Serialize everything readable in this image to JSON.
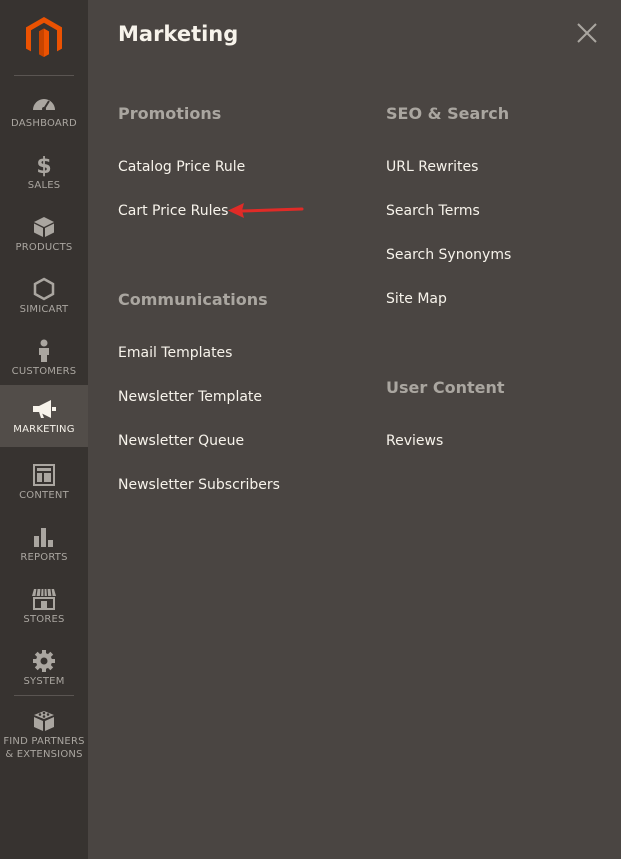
{
  "sidebar": {
    "items": [
      {
        "id": "dashboard",
        "label": "DASHBOARD",
        "icon": "dashboard-gauge-icon"
      },
      {
        "id": "sales",
        "label": "SALES",
        "icon": "dollar-icon"
      },
      {
        "id": "products",
        "label": "PRODUCTS",
        "icon": "box-icon"
      },
      {
        "id": "simicart",
        "label": "SIMICART",
        "icon": "hexagon-icon"
      },
      {
        "id": "customers",
        "label": "CUSTOMERS",
        "icon": "person-icon"
      },
      {
        "id": "marketing",
        "label": "MARKETING",
        "icon": "megaphone-icon",
        "active": true
      },
      {
        "id": "content",
        "label": "CONTENT",
        "icon": "layout-icon"
      },
      {
        "id": "reports",
        "label": "REPORTS",
        "icon": "bar-chart-icon"
      },
      {
        "id": "stores",
        "label": "STORES",
        "icon": "storefront-icon"
      },
      {
        "id": "system",
        "label": "SYSTEM",
        "icon": "gear-icon"
      }
    ],
    "partners": {
      "line1": "FIND PARTNERS",
      "line2": "& EXTENSIONS",
      "icon": "blocks-icon"
    }
  },
  "panel": {
    "title": "Marketing",
    "promotions": {
      "heading": "Promotions",
      "links": [
        "Catalog Price Rule",
        "Cart Price Rules"
      ]
    },
    "communications": {
      "heading": "Communications",
      "links": [
        "Email Templates",
        "Newsletter Template",
        "Newsletter Queue",
        "Newsletter Subscribers"
      ]
    },
    "seo": {
      "heading": "SEO & Search",
      "links": [
        "URL Rewrites",
        "Search Terms",
        "Search Synonyms",
        "Site Map"
      ]
    },
    "user_content": {
      "heading": "User Content",
      "links": [
        "Reviews"
      ]
    }
  },
  "colors": {
    "accent": "#eb5202",
    "arrow": "#e02b27",
    "panel_bg": "#4a4542",
    "sidebar_bg": "#373330"
  }
}
